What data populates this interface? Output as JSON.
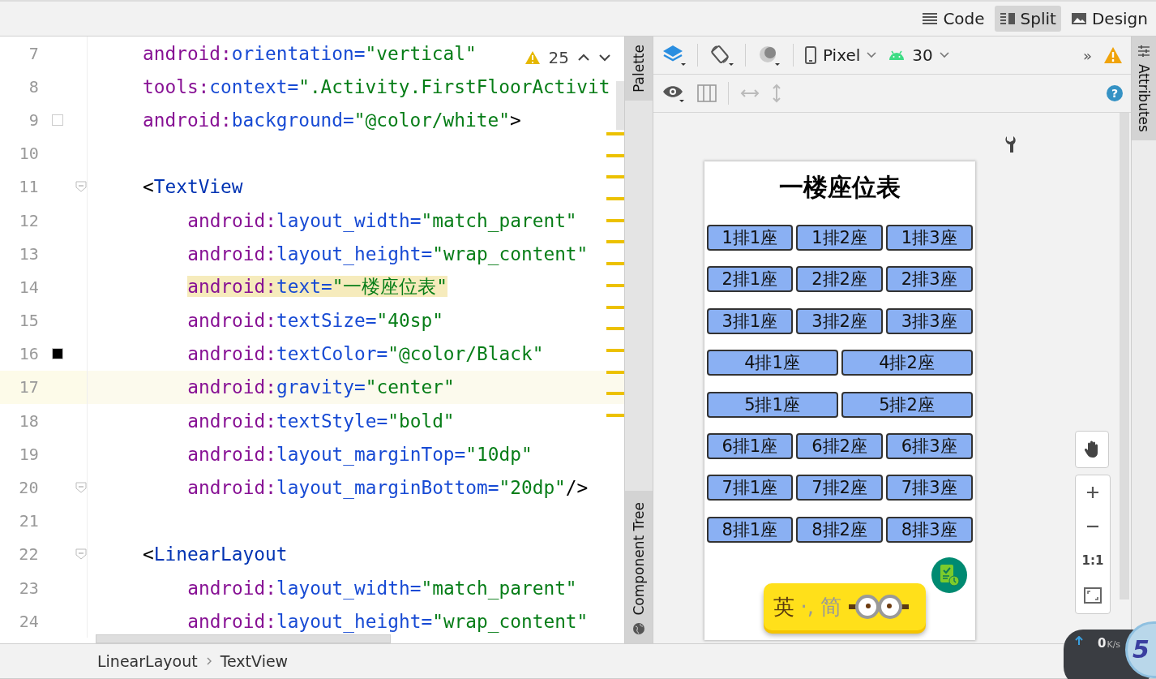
{
  "view_modes": [
    {
      "label": "Code",
      "kind": "code",
      "selected": false
    },
    {
      "label": "Split",
      "kind": "split",
      "selected": true
    },
    {
      "label": "Design",
      "kind": "design",
      "selected": false
    }
  ],
  "editor": {
    "warnings": "25",
    "lines": [
      {
        "num": "7",
        "tokens": [
          {
            "kind": "ns",
            "text": "android:"
          },
          {
            "kind": "attr",
            "text": "orientation="
          },
          {
            "kind": "str",
            "text": "\"vertical\""
          }
        ]
      },
      {
        "num": "8",
        "tokens": [
          {
            "kind": "ns",
            "text": "tools:"
          },
          {
            "kind": "attr",
            "text": "context="
          },
          {
            "kind": "str",
            "text": "\".Activity.FirstFloorActivit"
          }
        ]
      },
      {
        "num": "9",
        "color": "#ffffff",
        "tokens": [
          {
            "kind": "ns",
            "text": "android:"
          },
          {
            "kind": "attr",
            "text": "background="
          },
          {
            "kind": "str",
            "text": "\"@color/white\""
          },
          {
            "kind": "plain",
            "text": ">"
          }
        ]
      },
      {
        "num": "10"
      },
      {
        "num": "11",
        "fold": true,
        "tokens": [
          {
            "kind": "plain",
            "text": "<"
          },
          {
            "kind": "tag",
            "text": "TextView"
          }
        ],
        "children": [
          {
            "num": "12",
            "tokens": [
              {
                "kind": "ns",
                "text": "android:"
              },
              {
                "kind": "attr",
                "text": "layout_width="
              },
              {
                "kind": "str",
                "text": "\"match_parent\""
              }
            ]
          },
          {
            "num": "13",
            "tokens": [
              {
                "kind": "ns",
                "text": "android:"
              },
              {
                "kind": "attr",
                "text": "layout_height="
              },
              {
                "kind": "str",
                "text": "\"wrap_content\""
              }
            ]
          },
          {
            "num": "14",
            "highlight": true,
            "tokens": [
              {
                "kind": "ns",
                "text": "android:"
              },
              {
                "kind": "attr",
                "text": "text="
              },
              {
                "kind": "str",
                "text": "\"一楼座位表\""
              }
            ]
          },
          {
            "num": "15",
            "tokens": [
              {
                "kind": "ns",
                "text": "android:"
              },
              {
                "kind": "attr",
                "text": "textSize="
              },
              {
                "kind": "str",
                "text": "\"40sp\""
              }
            ]
          },
          {
            "num": "16",
            "color": "#000000",
            "tokens": [
              {
                "kind": "ns",
                "text": "android:"
              },
              {
                "kind": "attr",
                "text": "textColor="
              },
              {
                "kind": "str",
                "text": "\"@color/Black\""
              }
            ]
          },
          {
            "num": "17",
            "current": true,
            "tokens": [
              {
                "kind": "ns",
                "text": "android:"
              },
              {
                "kind": "attr",
                "text": "gravity="
              },
              {
                "kind": "str",
                "text": "\"center\""
              }
            ]
          },
          {
            "num": "18",
            "tokens": [
              {
                "kind": "ns",
                "text": "android:"
              },
              {
                "kind": "attr",
                "text": "textStyle="
              },
              {
                "kind": "str",
                "text": "\"bold\""
              }
            ]
          },
          {
            "num": "19",
            "tokens": [
              {
                "kind": "ns",
                "text": "android:"
              },
              {
                "kind": "attr",
                "text": "layout_marginTop="
              },
              {
                "kind": "str",
                "text": "\"10dp\""
              }
            ]
          },
          {
            "num": "20",
            "fold": true,
            "tokens": [
              {
                "kind": "ns",
                "text": "android:"
              },
              {
                "kind": "attr",
                "text": "layout_marginBottom="
              },
              {
                "kind": "str",
                "text": "\"20dp\""
              },
              {
                "kind": "plain",
                "text": "/>"
              }
            ]
          }
        ]
      },
      {
        "num": "21"
      },
      {
        "num": "22",
        "fold": true,
        "tokens": [
          {
            "kind": "plain",
            "text": "<"
          },
          {
            "kind": "tag",
            "text": "LinearLayout"
          }
        ],
        "children": [
          {
            "num": "23",
            "tokens": [
              {
                "kind": "ns",
                "text": "android:"
              },
              {
                "kind": "attr",
                "text": "layout_width="
              },
              {
                "kind": "str",
                "text": "\"match_parent\""
              }
            ]
          },
          {
            "num": "24",
            "tokens": [
              {
                "kind": "ns",
                "text": "android:"
              },
              {
                "kind": "attr",
                "text": "layout_height="
              },
              {
                "kind": "str",
                "text": "\"wrap_content\""
              }
            ]
          }
        ]
      }
    ]
  },
  "side_tabs": {
    "palette": "Palette",
    "component_tree": "Component Tree",
    "attributes": "Attributes"
  },
  "design_toolbar": {
    "device": "Pixel",
    "api": "30",
    "overflow": "»",
    "help": "?"
  },
  "preview": {
    "title": "一楼座位表",
    "rows": [
      [
        "1排1座",
        "1排2座",
        "1排3座"
      ],
      [
        "2排1座",
        "2排2座",
        "2排3座"
      ],
      [
        "3排1座",
        "3排2座",
        "3排3座"
      ],
      [
        "4排1座",
        "4排2座"
      ],
      [
        "5排1座",
        "5排2座"
      ],
      [
        "6排1座",
        "6排2座",
        "6排3座"
      ],
      [
        "7排1座",
        "7排2座",
        "7排3座"
      ],
      [
        "8排1座",
        "8排2座",
        "8排3座"
      ]
    ],
    "ime": {
      "english": "英",
      "punct": "·,",
      "simplified": "简"
    }
  },
  "zoom_controls": {
    "actual_size": "1:1"
  },
  "breadcrumbs": [
    "LinearLayout",
    "TextView"
  ],
  "net_widget": {
    "speed": "0",
    "unit": "K/s",
    "badge": "5"
  }
}
